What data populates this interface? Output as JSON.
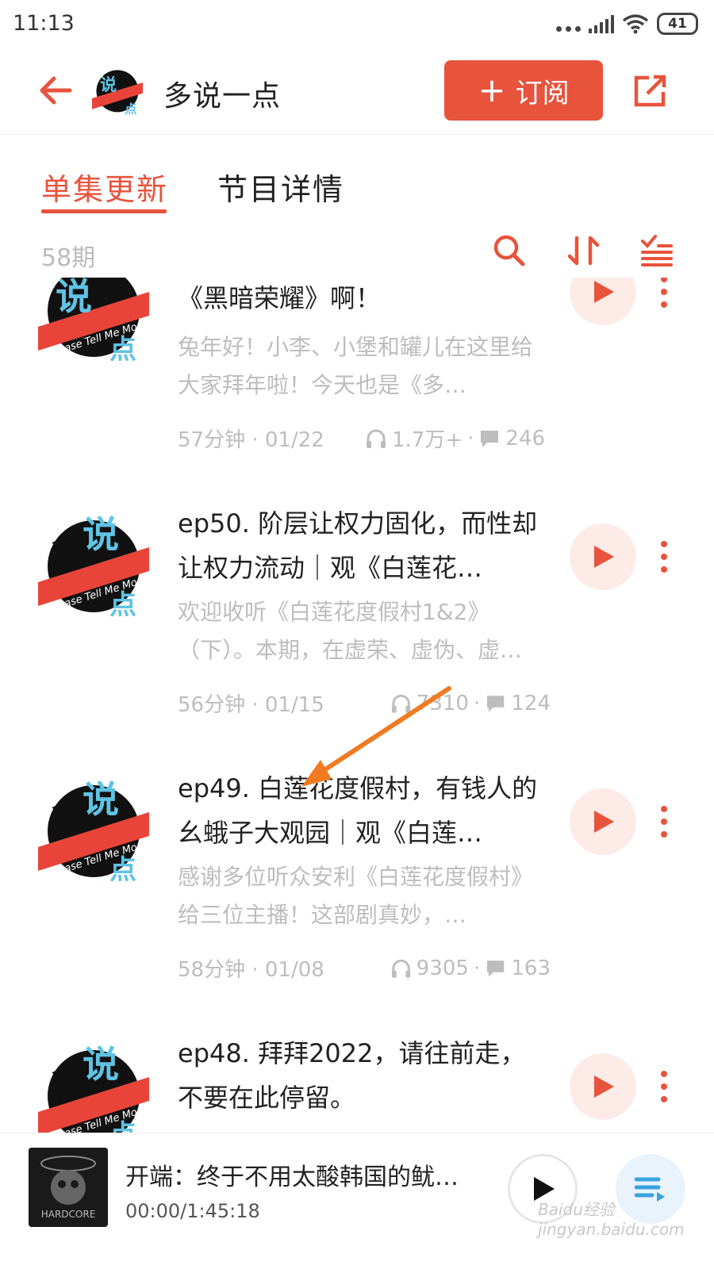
{
  "status_bar": {
    "time": "11:13",
    "battery": "41"
  },
  "header": {
    "title": "多说一点",
    "subscribe_label": "订阅",
    "plus": "+"
  },
  "tabs": [
    {
      "label": "单集更新",
      "active": true
    },
    {
      "label": "节目详情",
      "active": false
    }
  ],
  "toolbar": {
    "count": "58期"
  },
  "episodes": [
    {
      "title": "《黑暗荣耀》啊！",
      "description": "兔年好！小李、小堡和罐儿在这里给大家拜年啦！今天也是《多…",
      "duration_date": "57分钟 · 01/22",
      "plays": "1.7万+",
      "comments": "246"
    },
    {
      "title": "ep50. 阶层让权力固化，而性却让权力流动｜观《白莲花…",
      "description": "欢迎收听《白莲花度假村1&2》（下）。本期，在虚荣、虚伪、虚…",
      "duration_date": "56分钟 · 01/15",
      "plays": "7310",
      "comments": "124"
    },
    {
      "title": "ep49. 白莲花度假村，有钱人的幺蛾子大观园｜观《白莲…",
      "description": "感谢多位听众安利《白莲花度假村》给三位主播！这部剧真妙，…",
      "duration_date": "58分钟 · 01/08",
      "plays": "9305",
      "comments": "163"
    },
    {
      "title": "ep48. 拜拜2022，请往前走，不要在此停留。",
      "description": "",
      "duration_date": "",
      "plays": "",
      "comments": ""
    }
  ],
  "player": {
    "title": "开端：终于不用太酸韩国的鱿…",
    "time": "00:00/1:45:18",
    "cover_text": "HARDCORE"
  },
  "watermark": {
    "brand": "Baidu经验",
    "url": "jingyan.baidu.com"
  },
  "colors": {
    "accent": "#e8533c",
    "play_bg": "#fdebe8",
    "muted": "#bdbdbd"
  }
}
